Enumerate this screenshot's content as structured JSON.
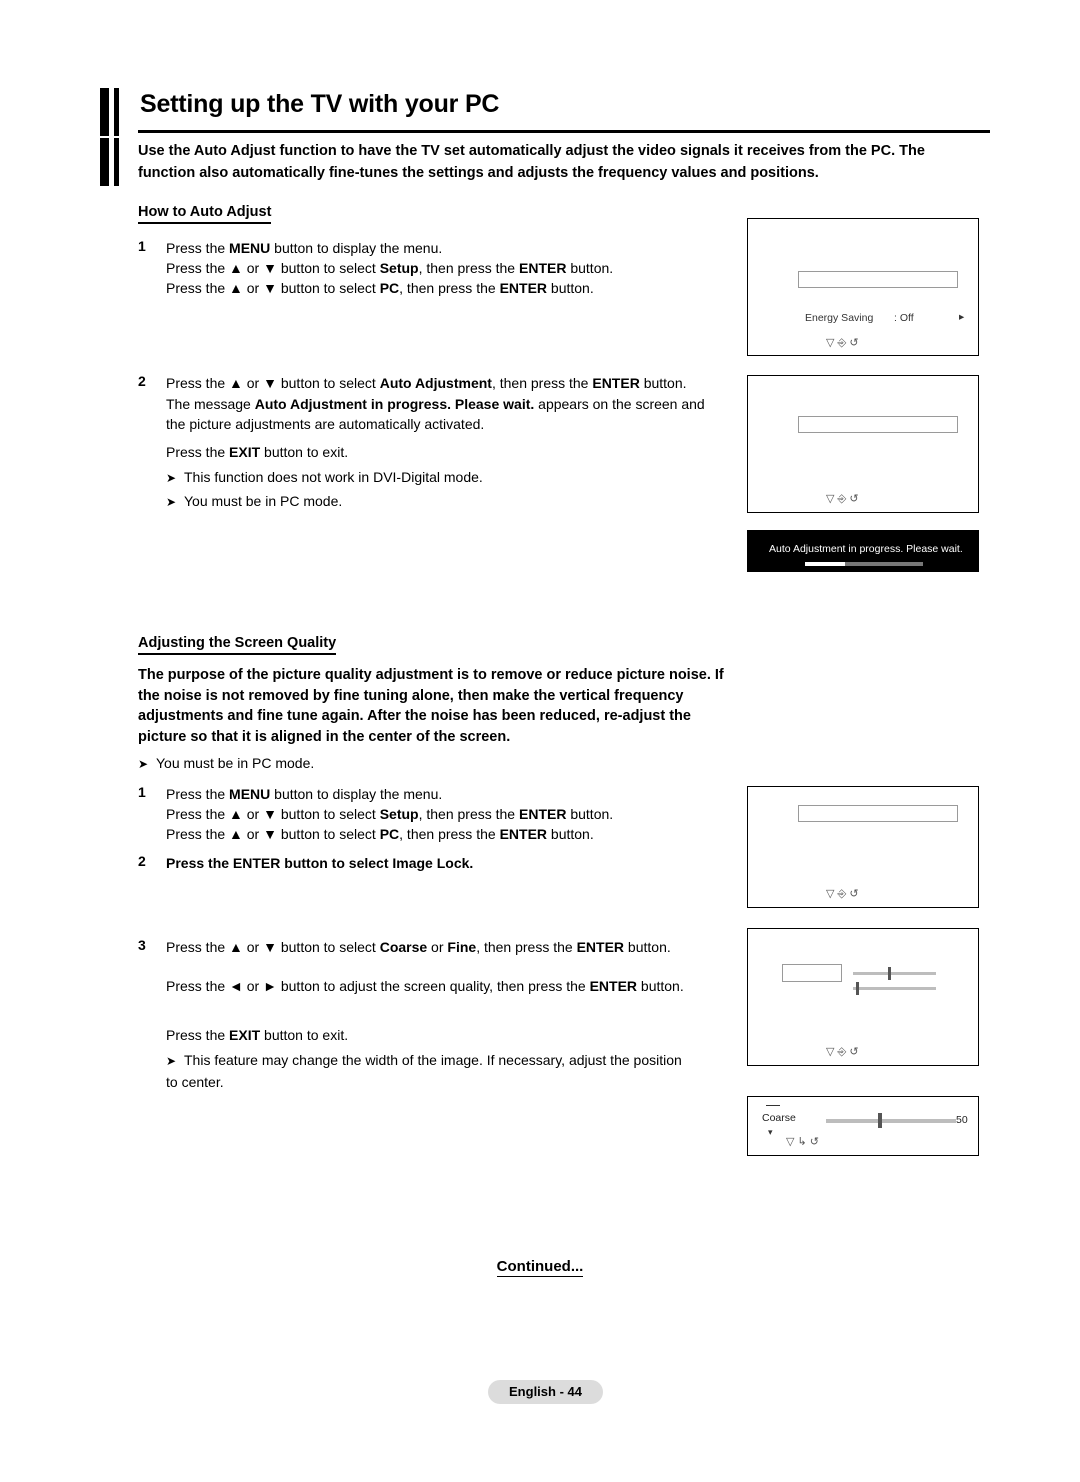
{
  "title": "Setting up the TV with your PC",
  "intro": "Use the Auto Adjust function to have the TV set automatically adjust the video signals it receives from the PC. The function also automatically fine-tunes the settings and adjusts the frequency values and positions.",
  "sections": {
    "auto_adjust": {
      "heading": "How to Auto Adjust",
      "step1_num": "1",
      "step1_line1": "Press the MENU button to display the menu.",
      "step1_line2": "Press the ▲ or ▼ button to select Setup, then press the ENTER button.",
      "step1_line3": "Press the ▲ or ▼ button to select PC, then press the ENTER button.",
      "step2_num": "2",
      "step2_text": "Press the ▲ or ▼ button to select Auto Adjustment, then press the ENTER button. The message Auto Adjustment in progress. Please wait. appears on the screen and the picture adjustments are automatically activated.",
      "exit_text": "Press the EXIT button to exit.",
      "note1": "This function does not work in DVI-Digital mode.",
      "note2": "You must be in PC mode."
    },
    "screen_quality": {
      "heading": "Adjusting the Screen Quality",
      "paragraph": "The purpose of the picture quality adjustment is to remove or reduce picture noise. If the noise is not removed by fine tuning alone, then make the vertical frequency adjustments and fine tune again. After the noise has been reduced, re-adjust the picture so that it is aligned in the center of the screen.",
      "note_pc": "You must be in PC mode.",
      "step1_num": "1",
      "step1_line1": "Press the MENU button to display the menu.",
      "step1_line2": "Press the ▲ or ▼ button to select Setup, then press the ENTER button.",
      "step1_line3": "Press the ▲ or ▼ button to select PC, then press the ENTER button.",
      "step2_num": "2",
      "step2_text": "Press the ENTER button to select Image Lock.",
      "step3_num": "3",
      "step3_line1": "Press the ▲ or ▼ button to select Coarse or Fine, then press the ENTER button.",
      "step3_line2": "Press the ◄ or ► button to adjust the screen quality, then press the ENTER button.",
      "exit_text": "Press the EXIT button to exit.",
      "note_width": "This feature may change the width of the image. If necessary, adjust the position to center."
    }
  },
  "tv_panels": {
    "panel1": {
      "row_label": "Energy Saving",
      "row_value": ": Off",
      "arrow": "▸",
      "icons": "▽   ⎆   ↺"
    },
    "panel2": {
      "icons": "▽   ⎆   ↺"
    },
    "message_bar": {
      "text": "Auto Adjustment in progress. Please wait."
    },
    "panel3": {
      "icons": "▽   ⎆   ↺"
    },
    "panel4": {
      "icons": "▽   ⎆   ↺"
    },
    "coarse_panel": {
      "label": "Coarse",
      "value": "50",
      "icons": "▽   ↳   ↺"
    }
  },
  "continued": "Continued...",
  "footer": "English - 44"
}
